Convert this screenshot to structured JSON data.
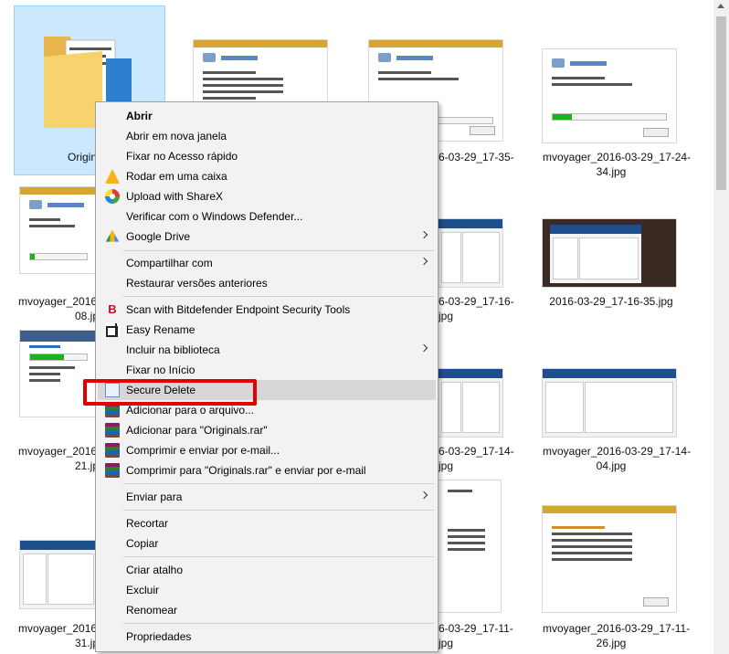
{
  "explorer": {
    "tiles": [
      {
        "caption_line1": "Origin",
        "caption_line2": ""
      },
      {
        "caption_line1": "",
        "caption_line2": ""
      },
      {
        "caption_line1": "6-03-29_17-35-",
        "caption_line2": ""
      },
      {
        "caption_line1": "mvoyager_2016-03-29_17-24-",
        "caption_line2": "34.jpg"
      },
      {
        "caption_line1": "mvoyager_2016",
        "caption_line2": "08.jpg"
      },
      {
        "caption_line1": "6-03-29_17-16-",
        "caption_line2": "jpg"
      },
      {
        "caption_line1": "2016-03-29_17-16-35.jpg",
        "caption_line2": ""
      },
      {
        "caption_line1": "mvoyager_2016",
        "caption_line2": "21.jpg"
      },
      {
        "caption_line1": "6-03-29_17-14-",
        "caption_line2": "jpg"
      },
      {
        "caption_line1": "mvoyager_2016-03-29_17-14-",
        "caption_line2": "04.jpg"
      },
      {
        "caption_line1": "mvoyager_2016",
        "caption_line2": "31.jpg"
      },
      {
        "caption_line1": "6-03-29_17-11-",
        "caption_line2": "jpg"
      },
      {
        "caption_line1": "mvoyager_2016-03-29_17-11-",
        "caption_line2": "26.jpg"
      }
    ]
  },
  "context_menu": {
    "items": [
      {
        "label": "Abrir",
        "bold": true
      },
      {
        "label": "Abrir em nova janela"
      },
      {
        "label": "Fixar no Acesso rápido"
      },
      {
        "label": "Rodar em uma caixa",
        "icon": "pizza-icon"
      },
      {
        "label": "Upload with ShareX",
        "icon": "sharex-icon"
      },
      {
        "label": "Verificar com o Windows Defender..."
      },
      {
        "label": "Google Drive",
        "icon": "google-drive-icon",
        "submenu": true
      },
      {
        "label": "Compartilhar com",
        "submenu": true
      },
      {
        "label": "Restaurar versões anteriores"
      },
      {
        "label": "Scan with Bitdefender Endpoint Security Tools",
        "icon": "bitdefender-icon",
        "icon_glyph": "B"
      },
      {
        "label": "Easy Rename",
        "icon": "easy-rename-icon"
      },
      {
        "label": "Incluir na biblioteca",
        "submenu": true
      },
      {
        "label": "Fixar no Início"
      },
      {
        "label": "Secure Delete",
        "icon": "secure-delete-icon",
        "highlighted": true
      },
      {
        "label": "Adicionar para o arquivo...",
        "icon": "winrar-icon"
      },
      {
        "label": "Adicionar para \"Originals.rar\"",
        "icon": "winrar-icon"
      },
      {
        "label": "Comprimir e enviar por e-mail...",
        "icon": "winrar-icon"
      },
      {
        "label": "Comprimir para \"Originals.rar\" e enviar por e-mail",
        "icon": "winrar-icon"
      },
      {
        "label": "Enviar para",
        "submenu": true
      },
      {
        "label": "Recortar"
      },
      {
        "label": "Copiar"
      },
      {
        "label": "Criar atalho"
      },
      {
        "label": "Excluir"
      },
      {
        "label": "Renomear"
      },
      {
        "label": "Propriedades"
      }
    ]
  },
  "colors": {
    "highlight_box": "#e30000",
    "selection": "#cce8ff",
    "menu_bg": "#f2f2f2"
  }
}
